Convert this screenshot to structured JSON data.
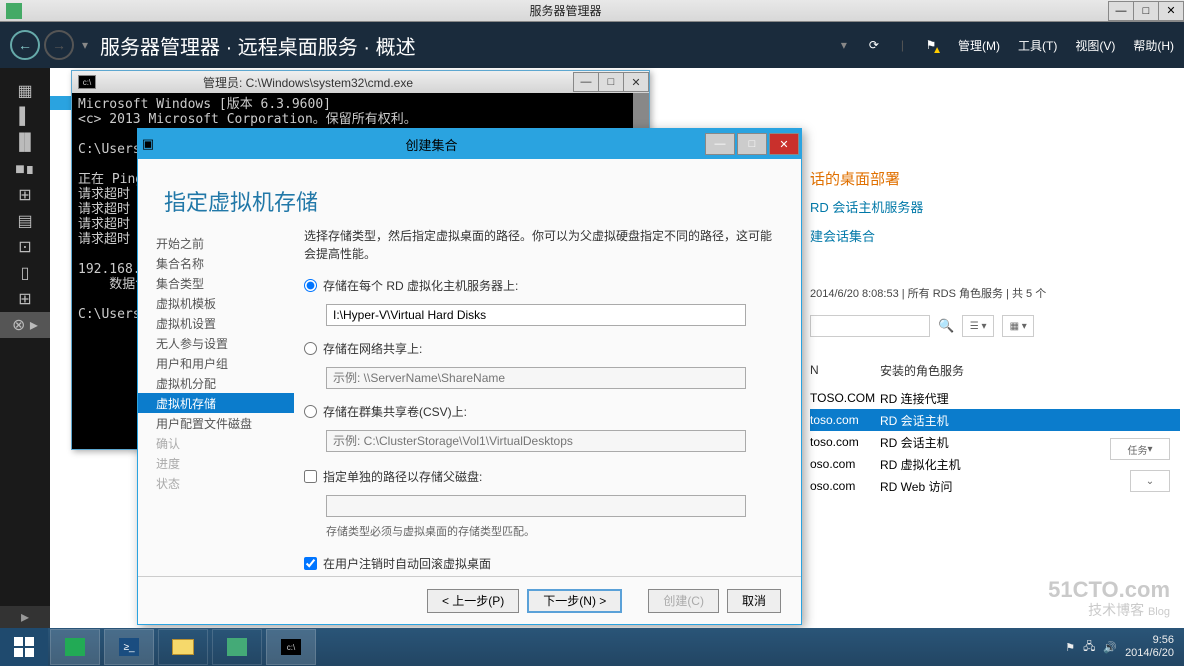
{
  "titlebar": {
    "title": "服务器管理器"
  },
  "ribbon": {
    "breadcrumb": "服务器管理器 · 远程桌面服务 · 概述",
    "menu": {
      "manage": "管理(M)",
      "tools": "工具(T)",
      "view": "视图(V)",
      "help": "帮助(H)"
    }
  },
  "cmd": {
    "title": "管理员: C:\\Windows\\system32\\cmd.exe",
    "lines": "Microsoft Windows [版本 6.3.9600]\n<c> 2013 Microsoft Corporation。保留所有权利。\n\nC:\\Users\\\n\n正在 Ping\n请求超时\n请求超时\n请求超时\n请求超时\n\n192.168.0\n    数据包\n\nC:\\Users\\"
  },
  "bg": {
    "orangeTitle": "话的桌面部署",
    "link1": "RD 会话主机服务器",
    "link2": "建会话集合",
    "statusLine": "2014/6/20 8:08:53 | 所有 RDS 角色服务 | 共 5 个",
    "tasksLabel": "任务",
    "colN": "N",
    "colRole": "安装的角色服务",
    "rows": [
      {
        "host": "TOSO.COM",
        "role": "RD 连接代理",
        "sel": false
      },
      {
        "host": "toso.com",
        "role": "RD 会话主机",
        "sel": true
      },
      {
        "host": "toso.com",
        "role": "RD 会话主机",
        "sel": false
      },
      {
        "host": "oso.com",
        "role": "RD 虚拟化主机",
        "sel": false
      },
      {
        "host": "oso.com",
        "role": "RD Web 访问",
        "sel": false
      }
    ]
  },
  "wizard": {
    "title": "创建集合",
    "header": "指定虚拟机存储",
    "nav": [
      {
        "label": "开始之前",
        "state": ""
      },
      {
        "label": "集合名称",
        "state": ""
      },
      {
        "label": "集合类型",
        "state": ""
      },
      {
        "label": "虚拟机模板",
        "state": ""
      },
      {
        "label": "虚拟机设置",
        "state": ""
      },
      {
        "label": "无人参与设置",
        "state": ""
      },
      {
        "label": "用户和用户组",
        "state": ""
      },
      {
        "label": "虚拟机分配",
        "state": ""
      },
      {
        "label": "虚拟机存储",
        "state": "sel"
      },
      {
        "label": "用户配置文件磁盘",
        "state": ""
      },
      {
        "label": "确认",
        "state": "disabled"
      },
      {
        "label": "进度",
        "state": "disabled"
      },
      {
        "label": "状态",
        "state": "disabled"
      }
    ],
    "desc": "选择存储类型，然后指定虚拟桌面的路径。你可以为父虚拟硬盘指定不同的路径，这可能会提高性能。",
    "opt1": "存储在每个 RD 虚拟化主机服务器上:",
    "opt1Value": "I:\\Hyper-V\\Virtual Hard Disks",
    "opt2": "存储在网络共享上:",
    "opt2Placeholder": "示例: \\\\ServerName\\ShareName",
    "opt3": "存储在群集共享卷(CSV)上:",
    "opt3Placeholder": "示例: C:\\ClusterStorage\\Vol1\\VirtualDesktops",
    "cb1": "指定单独的路径以存储父磁盘:",
    "note": "存储类型必须与虚拟桌面的存储类型匹配。",
    "cb2": "在用户注销时自动回滚虚拟桌面",
    "buttons": {
      "prev": "< 上一步(P)",
      "next": "下一步(N) >",
      "create": "创建(C)",
      "cancel": "取消"
    }
  },
  "tray": {
    "time": "9:56",
    "date": "2014/6/20"
  },
  "watermark": {
    "l1": "51CTO.com",
    "l2": "技术博客",
    "l3": "Blog"
  }
}
